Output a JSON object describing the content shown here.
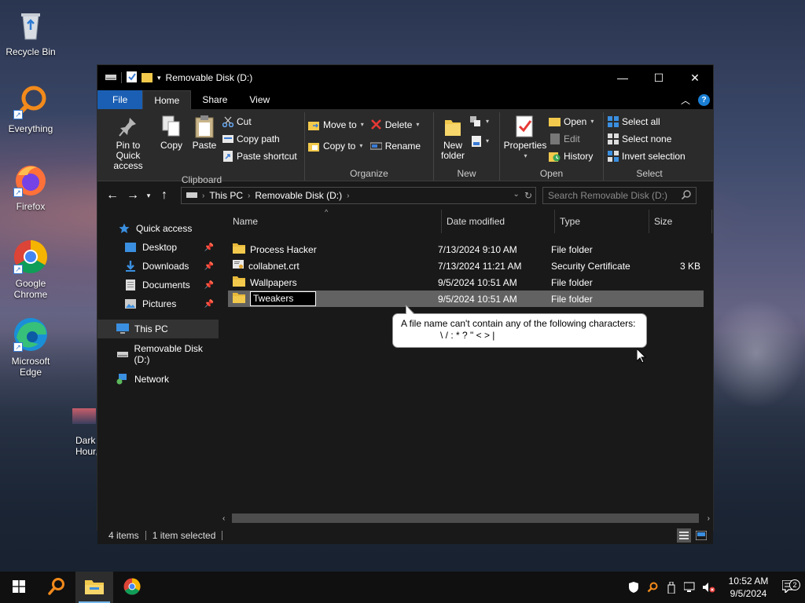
{
  "desktop": {
    "icons": [
      {
        "label": "Recycle Bin"
      },
      {
        "label": "Everything"
      },
      {
        "label": "Firefox"
      },
      {
        "label": "Google Chrome"
      },
      {
        "label": "Microsoft Edge"
      },
      {
        "label": "Dark Hour,"
      }
    ]
  },
  "window": {
    "title": "Removable Disk (D:)",
    "controls": {
      "minimize": "—",
      "maximize": "☐",
      "close": "✕"
    }
  },
  "tabs": {
    "file": "File",
    "home": "Home",
    "share": "Share",
    "view": "View"
  },
  "ribbon": {
    "clipboard": {
      "label": "Clipboard",
      "pin": "Pin to Quick access",
      "copy": "Copy",
      "paste": "Paste",
      "cut": "Cut",
      "copy_path": "Copy path",
      "paste_shortcut": "Paste shortcut"
    },
    "organize": {
      "label": "Organize",
      "move_to": "Move to",
      "copy_to": "Copy to",
      "delete": "Delete",
      "rename": "Rename"
    },
    "new": {
      "label": "New",
      "new_folder": "New folder"
    },
    "open": {
      "label": "Open",
      "properties": "Properties",
      "open": "Open",
      "edit": "Edit",
      "history": "History"
    },
    "select": {
      "label": "Select",
      "select_all": "Select all",
      "select_none": "Select none",
      "invert": "Invert selection"
    }
  },
  "address": {
    "crumbs": [
      "This PC",
      "Removable Disk (D:)"
    ],
    "search_placeholder": "Search Removable Disk (D:)"
  },
  "nav": {
    "quick_access": "Quick access",
    "desktop": "Desktop",
    "downloads": "Downloads",
    "documents": "Documents",
    "pictures": "Pictures",
    "this_pc": "This PC",
    "removable": "Removable Disk (D:)",
    "network": "Network"
  },
  "columns": {
    "name": "Name",
    "date": "Date modified",
    "type": "Type",
    "size": "Size"
  },
  "files": [
    {
      "name": "Process Hacker",
      "date": "7/13/2024 9:10 AM",
      "type": "File folder",
      "size": "",
      "icon": "folder-icon"
    },
    {
      "name": "collabnet.crt",
      "date": "7/13/2024 11:21 AM",
      "type": "Security Certificate",
      "size": "3 KB",
      "icon": "certificate-icon"
    },
    {
      "name": "Wallpapers",
      "date": "9/5/2024 10:51 AM",
      "type": "File folder",
      "size": "",
      "icon": "folder-icon"
    },
    {
      "name": "Tweakers",
      "date": "9/5/2024 10:51 AM",
      "type": "File folder",
      "size": "",
      "icon": "folder-icon"
    }
  ],
  "tooltip": {
    "line1": "A file name can't contain any of the following characters:",
    "line2": "\\ / : * ? \" < > |"
  },
  "status": {
    "count": "4 items",
    "selected": "1 item selected"
  },
  "taskbar": {
    "time": "10:52 AM",
    "date": "9/5/2024",
    "notifications": "2"
  },
  "colors": {
    "accent": "#1a5fb4",
    "folder": "#f2c94c",
    "window_bg": "#191919",
    "ribbon_bg": "#2b2b2b",
    "selected_row": "#626262"
  }
}
